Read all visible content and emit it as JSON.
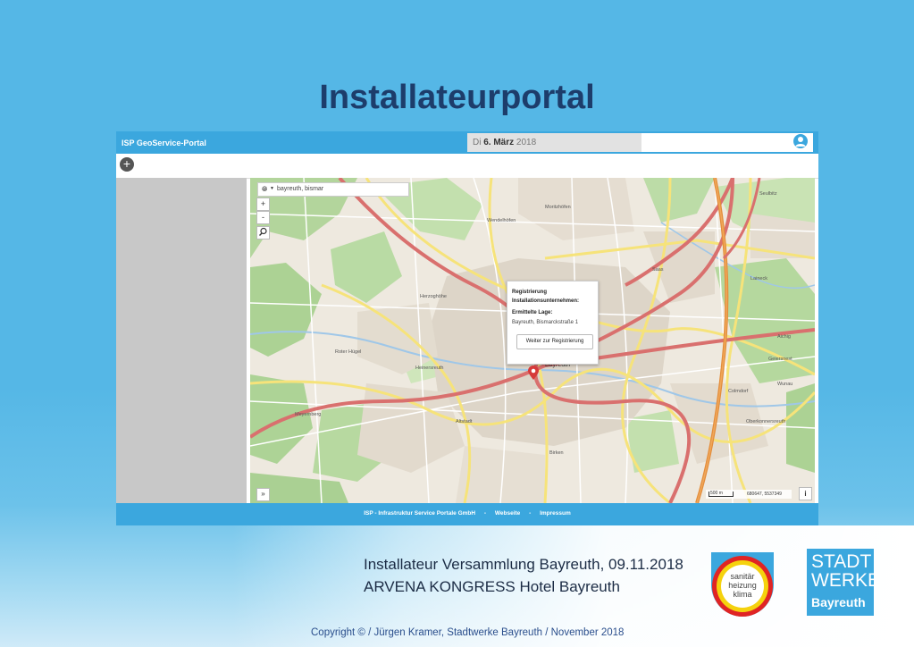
{
  "slide": {
    "title": "Installateurportal",
    "event_line1": "Installateur Versammlung Bayreuth, 09.11.2018",
    "event_line2": "ARVENA KONGRESS Hotel Bayreuth",
    "copyright": "Copyright © / Jürgen Kramer, Stadtwerke Bayreuth / November 2018"
  },
  "app": {
    "brand": "ISP GeoService-Portal",
    "date_day": "Di",
    "date_bold": "6. März",
    "date_year": "2018",
    "add_label": "+",
    "footer": {
      "company": "ISP - Infrastruktur Service Portale GmbH",
      "sep": "-",
      "link1": "Webseite",
      "link2": "Impressum"
    }
  },
  "map": {
    "search_value": "bayreuth, bismar",
    "zoom_in": "+",
    "zoom_out": "-",
    "expand": "»",
    "info": "i",
    "scale_label": "500 m",
    "coords": "680647, 5537349",
    "popup": {
      "line1": "Registrierung",
      "line2": "Installationsunternehmen:",
      "line3": "Ermittelte Lage:",
      "line4": "Bayreuth, Bismarckstraße 1",
      "button": "Weiter zur Registrierung"
    },
    "labels": [
      "Bayreuth",
      "Herzoghöhe",
      "Meyernberg",
      "Heinersreuth",
      "Wendelhöfen",
      "Roter Hügel",
      "Geiersnest",
      "Aichig",
      "Colmdorf",
      "Wunau",
      "Oberkonnersreuth",
      "Altstadt",
      "Birken",
      "Moritzhöfen",
      "Saas",
      "Laineck",
      "Seulbitz"
    ]
  },
  "logos": {
    "badge_lines": [
      "sanitär",
      "heizung",
      "klima"
    ],
    "stadtwerke_1": "STADT",
    "stadtwerke_2": "WERKE",
    "stadtwerke_3": "Bayreuth"
  },
  "colors": {
    "brand_blue": "#3ba7de",
    "slide_blue": "#56b8e6",
    "title_navy": "#1d3d6b"
  }
}
